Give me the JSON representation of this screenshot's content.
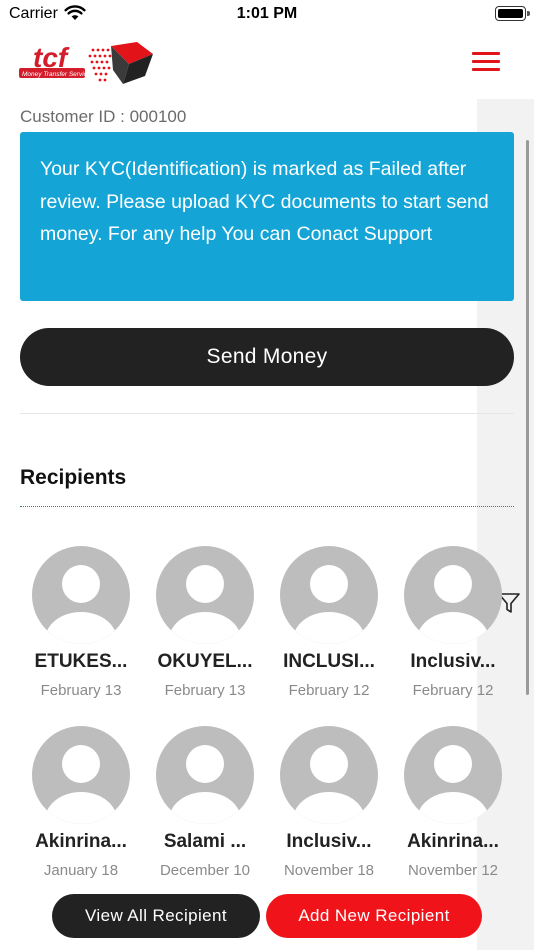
{
  "status_bar": {
    "carrier": "Carrier",
    "time": "1:01 PM"
  },
  "header": {
    "logo_text": "tcf",
    "logo_subtext": "Money Transfer Service"
  },
  "customer_id": "Customer ID : 000100",
  "kyc_banner": {
    "message": "Your KYC(Identification) is marked as Failed after review. Please upload KYC documents to start send money. For any help You can Conact Support"
  },
  "send_money_label": "Send Money",
  "recipients": {
    "title": "Recipients",
    "items": [
      {
        "name": "ETUKES...",
        "date": "February 13"
      },
      {
        "name": "OKUYEL...",
        "date": "February 13"
      },
      {
        "name": "INCLUSI...",
        "date": "February 12"
      },
      {
        "name": "Inclusiv...",
        "date": "February 12"
      },
      {
        "name": "Akinrina...",
        "date": "January 18"
      },
      {
        "name": "Salami ...",
        "date": "December 10"
      },
      {
        "name": "Inclusiv...",
        "date": "November 18"
      },
      {
        "name": "Akinrina...",
        "date": "November 12"
      }
    ]
  },
  "actions": {
    "view_all": "View All Recipient",
    "add_new": "Add New Recipient"
  },
  "colors": {
    "accent_red": "#e3131a",
    "banner_blue": "#14a5d6",
    "dark": "#222222"
  },
  "icons": [
    "wifi-icon",
    "battery-icon",
    "menu-icon",
    "filter-icon",
    "avatar-placeholder-icon"
  ]
}
